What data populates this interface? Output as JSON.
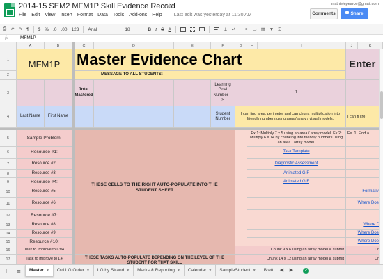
{
  "app": {
    "doc_title": "2014-15 SEM2 MFM1P Skill Evidence Record",
    "user_email": "mathielepearce@gmail.com",
    "comments_label": "Comments",
    "share_label": "Share"
  },
  "menu": {
    "items": [
      "File",
      "Edit",
      "View",
      "Insert",
      "Format",
      "Data",
      "Tools",
      "Add-ons",
      "Help"
    ],
    "last_edit": "Last edit was yesterday at 11:30 AM"
  },
  "toolbar": {
    "currency": "$",
    "percent": "%",
    "decimal_less": ".0",
    "decimal_more": ".00",
    "number_format": "123",
    "font": "Arial",
    "font_size": "18",
    "bold": "B",
    "italic": "I",
    "strike": "S",
    "text_color": "A",
    "sigma": "Σ"
  },
  "formula_bar": {
    "label": "fx",
    "content": "MFM1P"
  },
  "columns": [
    "A",
    "B",
    "C",
    "D",
    "E",
    "F",
    "G",
    "H",
    "I",
    "J",
    "K"
  ],
  "rows": [
    "1",
    "2",
    "3",
    "4",
    "5",
    "6",
    "7",
    "8",
    "9",
    "10",
    "11",
    "12",
    "13",
    "14",
    "15",
    "16",
    "17"
  ],
  "cells": {
    "a1": "MFM1P",
    "title": "Master Evidence Chart",
    "enter": "Enter",
    "message": "MESSAGE TO ALL STUDENTS:",
    "total_mastered": "Total Mastered",
    "learning_goal": "Learning Goal Number -->",
    "goal_1": "1",
    "last_name": "Last Name",
    "first_name": "First Name",
    "student_number": "Student Number",
    "goal_desc": "I can find area, perimeter and can chunk multiplication into friendly numbers using area / array / visual models.",
    "goal_desc_k": "I can fi cro",
    "sample_problem": "Sample Problem:",
    "sample_text": "Ex 1: Multiply 7 x 5 using an area / array model. Ex 2: Multiply 6 x 14 by chunking into friendly numbers using an area / array model.",
    "sample_k": "Ex. 1: Find a",
    "resource_1": "Resource #1:",
    "resource_2": "Resource #2:",
    "resource_3": "Resource #3:",
    "resource_4": "Resource #4:",
    "resource_5": "Resource #5:",
    "resource_6": "Resource #6:",
    "resource_7": "Resource #7:",
    "resource_8": "Resource #8:",
    "resource_9": "Resource #9:",
    "resource_10": "Resource #10:",
    "task_l3": "Task to Improve to L3/4",
    "task_l4": "Task to Improve to L4",
    "auto_pop": "THESE CELLS TO THE RIGHT AUTO-POPULATE INTO THE STUDENT SHEET",
    "tasks_auto": "THESE TASKS AUTO-POPULATE DEPENDING ON THE LEVEL OF THE STUDENT FOR THAT SKILL",
    "link_template": "Task Template",
    "link_diagnostic": "Diagnostic Assessment",
    "link_gif1": "Animated GIF",
    "link_gif2": "Animated GIF",
    "k_formative": "Formative",
    "k_where1": "Where Does",
    "k_where2": "Where Dr",
    "k_where3": "Where Does",
    "k_where4": "Where Does",
    "chunk_l3": "Chunk 9 x 6 using an array model & submit",
    "chunk_l4": "Chunk 14 x 12 using an array model & submit",
    "k_cre1": "Cre",
    "k_cre2": "Cre",
    "k_e": "E"
  },
  "sheet_tabs": [
    "Master",
    "Old LG Order",
    "LG by Strand",
    "Marks & Reporting",
    "Calendar",
    "SampleStudent",
    "Brett"
  ]
}
